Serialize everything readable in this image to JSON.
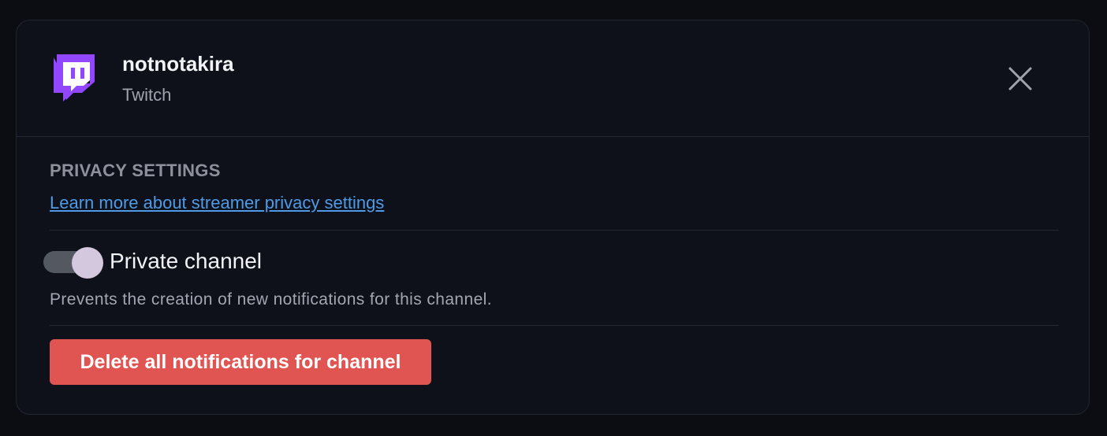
{
  "channel": {
    "name": "notnotakira",
    "platform": "Twitch"
  },
  "privacy": {
    "section_title": "PRIVACY SETTINGS",
    "learn_more_link": "Learn more about streamer privacy settings",
    "private_toggle_label": "Private channel",
    "private_toggle_on": true,
    "description": "Prevents the creation of new notifications for this channel."
  },
  "actions": {
    "delete_label": "Delete all notifications for channel"
  },
  "icons": {
    "logo": "twitch-logo-icon",
    "close": "close-icon"
  },
  "colors": {
    "twitch_purple": "#9146ff",
    "link": "#4f9ae6",
    "danger": "#e05552",
    "toggle_knob": "#d3c8dd"
  }
}
